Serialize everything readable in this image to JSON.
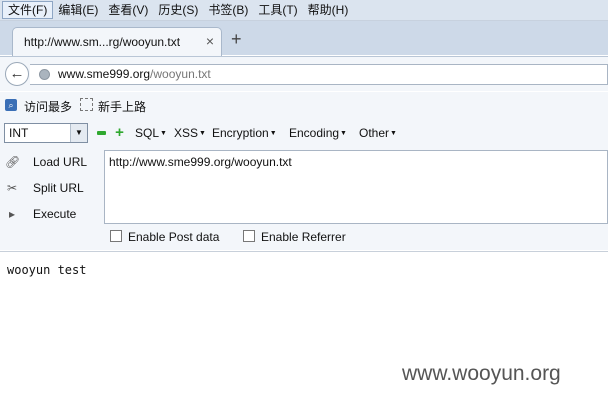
{
  "menubar": {
    "items": [
      "文件(F)",
      "编辑(E)",
      "查看(V)",
      "历史(S)",
      "书签(B)",
      "工具(T)",
      "帮助(H)"
    ]
  },
  "tab": {
    "title": "http://www.sm...rg/wooyun.txt",
    "close_icon": "×",
    "new_tab_icon": "+"
  },
  "navbar": {
    "back_icon": "back-arrow-icon",
    "url_domain": "www.sme999.org",
    "url_path": "/wooyun.txt"
  },
  "bookmarks": {
    "items": [
      "访问最多",
      "新手上路"
    ]
  },
  "hackbar": {
    "select_value": "INT",
    "menus": [
      "SQL",
      "XSS",
      "Encryption",
      "Encoding",
      "Other"
    ],
    "actions": [
      "Load URL",
      "Split URL",
      "Execute"
    ],
    "url_value": "http://www.sme999.org/wooyun.txt",
    "enable_post_label": "Enable Post data",
    "enable_referrer_label": "Enable Referrer"
  },
  "content": {
    "text": "wooyun test",
    "watermark": "www.wooyun.org"
  }
}
